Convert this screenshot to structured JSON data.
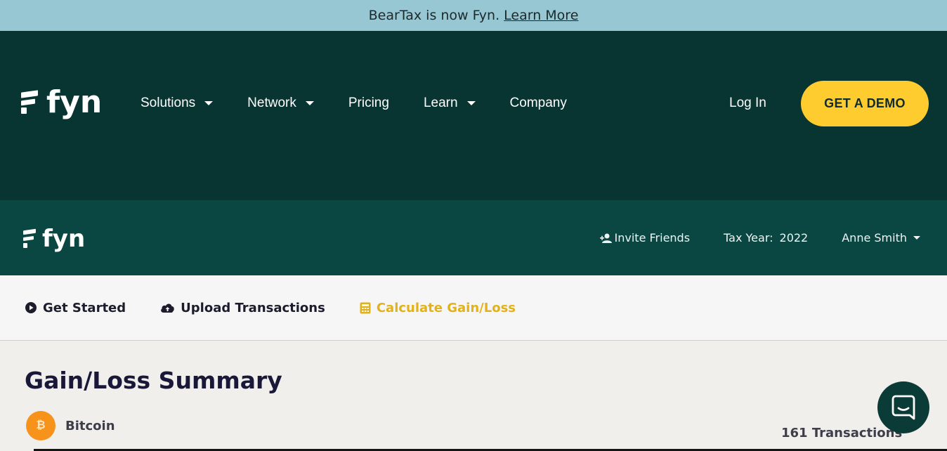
{
  "announcement": {
    "text": "BearTax is now Fyn.",
    "link": "Learn More"
  },
  "nav": {
    "logo": "fyn",
    "items": [
      {
        "label": "Solutions",
        "dropdown": true
      },
      {
        "label": "Network",
        "dropdown": true
      },
      {
        "label": "Pricing",
        "dropdown": false
      },
      {
        "label": "Learn",
        "dropdown": true
      },
      {
        "label": "Company",
        "dropdown": false
      }
    ],
    "login": "Log In",
    "cta": "GET A DEMO"
  },
  "app_header": {
    "logo": "fyn",
    "invite": "Invite Friends",
    "tax_year_label": "Tax Year:",
    "tax_year_value": "2022",
    "user": "Anne Smith"
  },
  "tabs": [
    {
      "label": "Get Started",
      "icon": "play-circle-icon"
    },
    {
      "label": "Upload Transactions",
      "icon": "cloud-upload-icon"
    },
    {
      "label": "Calculate Gain/Loss",
      "icon": "calculator-icon",
      "active": true
    }
  ],
  "summary": {
    "title": "Gain/Loss Summary",
    "coin_name": "Bitcoin",
    "coin_symbol": "₿",
    "transactions": "161 Transactions"
  },
  "colors": {
    "announcement_bg": "#97c7d3",
    "nav_bg": "#083532",
    "app_header_bg": "#0b4742",
    "cta": "#ffcc2f",
    "active_tab": "#e2b21d",
    "bitcoin": "#f7931a"
  }
}
